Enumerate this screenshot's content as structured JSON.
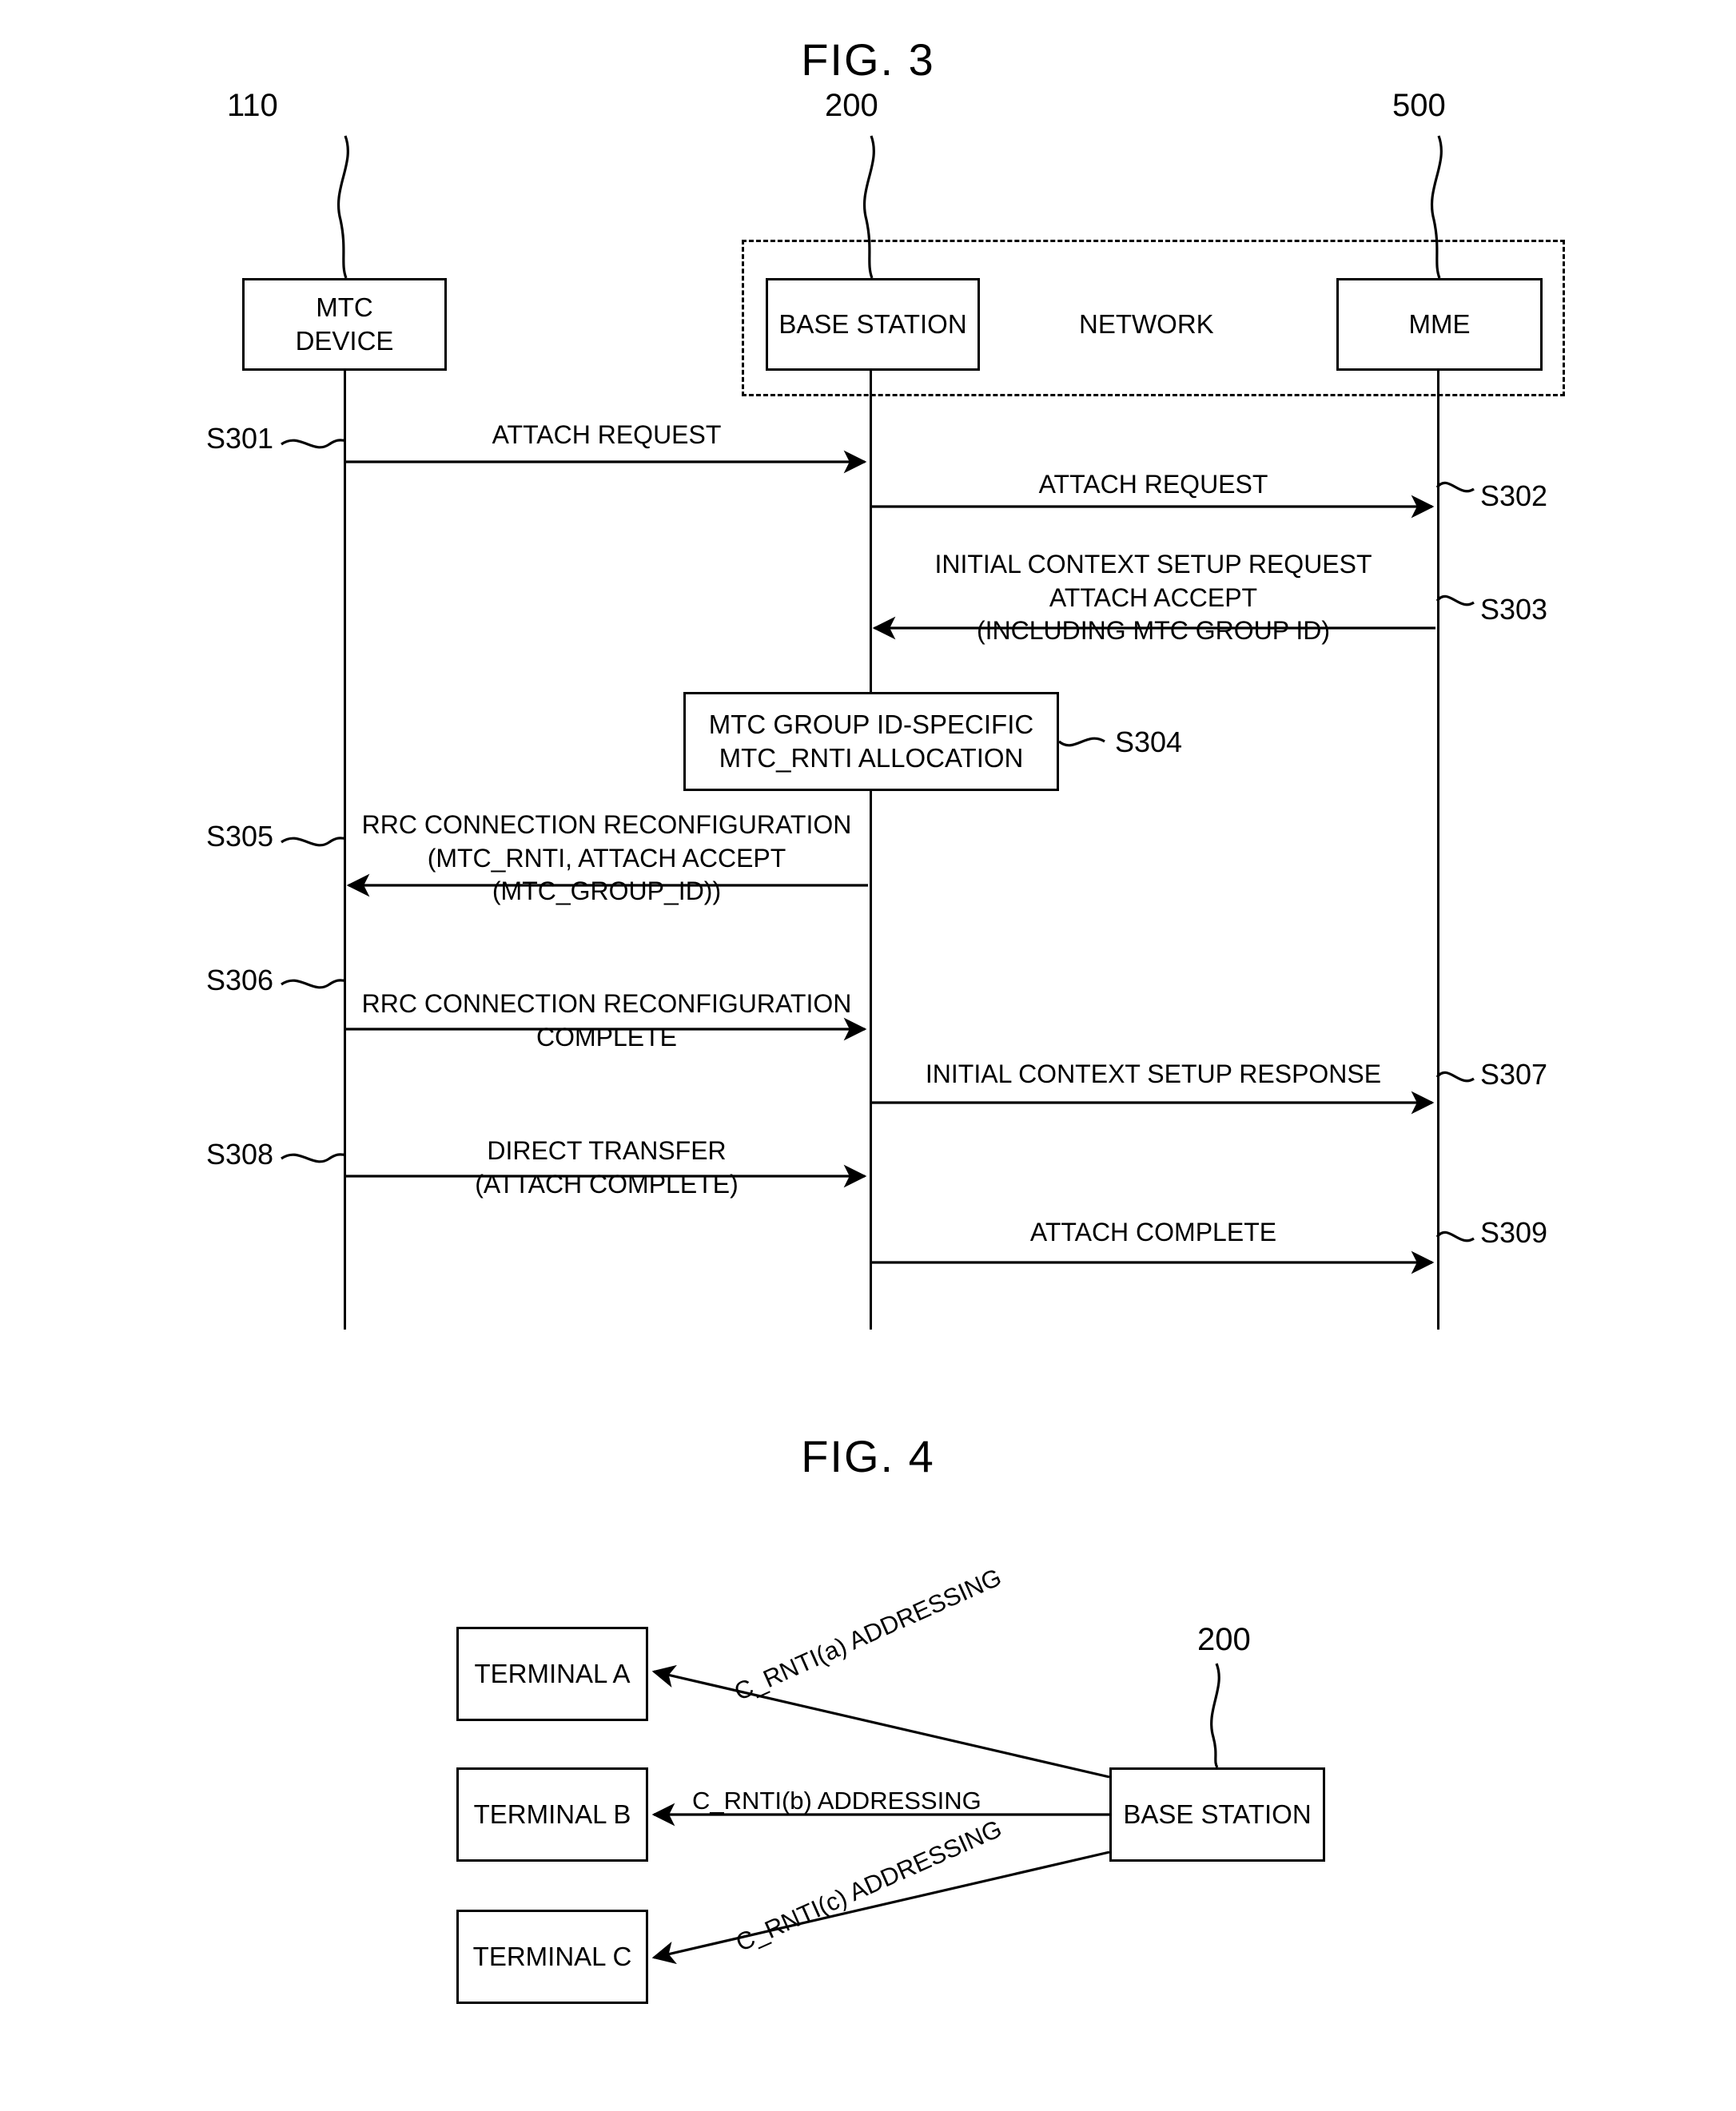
{
  "figures": {
    "fig3": {
      "title": "FIG. 3",
      "nodes": [
        {
          "id": "mtc-device",
          "label_line1": "MTC",
          "label_line2": "DEVICE",
          "ref": "110"
        },
        {
          "id": "base-station",
          "label_line1": "BASE STATION",
          "label_line2": "",
          "ref": "200"
        },
        {
          "id": "mme",
          "label_line1": "MME",
          "label_line2": "",
          "ref": "500"
        }
      ],
      "network_label": "NETWORK",
      "process_box": {
        "ref": "S304",
        "line1": "MTC GROUP ID-SPECIFIC",
        "line2": "MTC_RNTI ALLOCATION"
      },
      "messages": [
        {
          "ref": "S301",
          "ref_side": "left",
          "direction": "right",
          "from": "mtc-device",
          "to": "base-station",
          "lines": [
            "ATTACH REQUEST"
          ]
        },
        {
          "ref": "S302",
          "ref_side": "right",
          "direction": "right",
          "from": "base-station",
          "to": "mme",
          "lines": [
            "ATTACH REQUEST"
          ]
        },
        {
          "ref": "S303",
          "ref_side": "right",
          "direction": "left",
          "from": "mme",
          "to": "base-station",
          "lines": [
            "INITIAL CONTEXT SETUP REQUEST",
            "ATTACH ACCEPT",
            "(INCLUDING MTC GROUP ID)"
          ]
        },
        {
          "ref": "S305",
          "ref_side": "left",
          "direction": "left",
          "from": "base-station",
          "to": "mtc-device",
          "lines": [
            "RRC CONNECTION RECONFIGURATION",
            "(MTC_RNTI, ATTACH ACCEPT",
            "(MTC_GROUP_ID))"
          ]
        },
        {
          "ref": "S306",
          "ref_side": "left",
          "direction": "right",
          "from": "mtc-device",
          "to": "base-station",
          "lines": [
            "RRC CONNECTION RECONFIGURATION",
            "COMPLETE"
          ]
        },
        {
          "ref": "S307",
          "ref_side": "right",
          "direction": "right",
          "from": "base-station",
          "to": "mme",
          "lines": [
            "INITIAL CONTEXT SETUP RESPONSE"
          ]
        },
        {
          "ref": "S308",
          "ref_side": "left",
          "direction": "right",
          "from": "mtc-device",
          "to": "base-station",
          "lines": [
            "DIRECT TRANSFER",
            "(ATTACH COMPLETE)"
          ]
        },
        {
          "ref": "S309",
          "ref_side": "right",
          "direction": "right",
          "from": "base-station",
          "to": "mme",
          "lines": [
            "ATTACH COMPLETE"
          ]
        }
      ]
    },
    "fig4": {
      "title": "FIG. 4",
      "base_station": {
        "label": "BASE STATION",
        "ref": "200"
      },
      "terminals": [
        {
          "label": "TERMINAL A",
          "arrow_label": "C_RNTI(a) ADDRESSING"
        },
        {
          "label": "TERMINAL B",
          "arrow_label": "C_RNTI(b) ADDRESSING"
        },
        {
          "label": "TERMINAL C",
          "arrow_label": "C_RNTI(c) ADDRESSING"
        }
      ]
    }
  },
  "colors": {
    "ink": "#000000",
    "paper": "#ffffff"
  }
}
